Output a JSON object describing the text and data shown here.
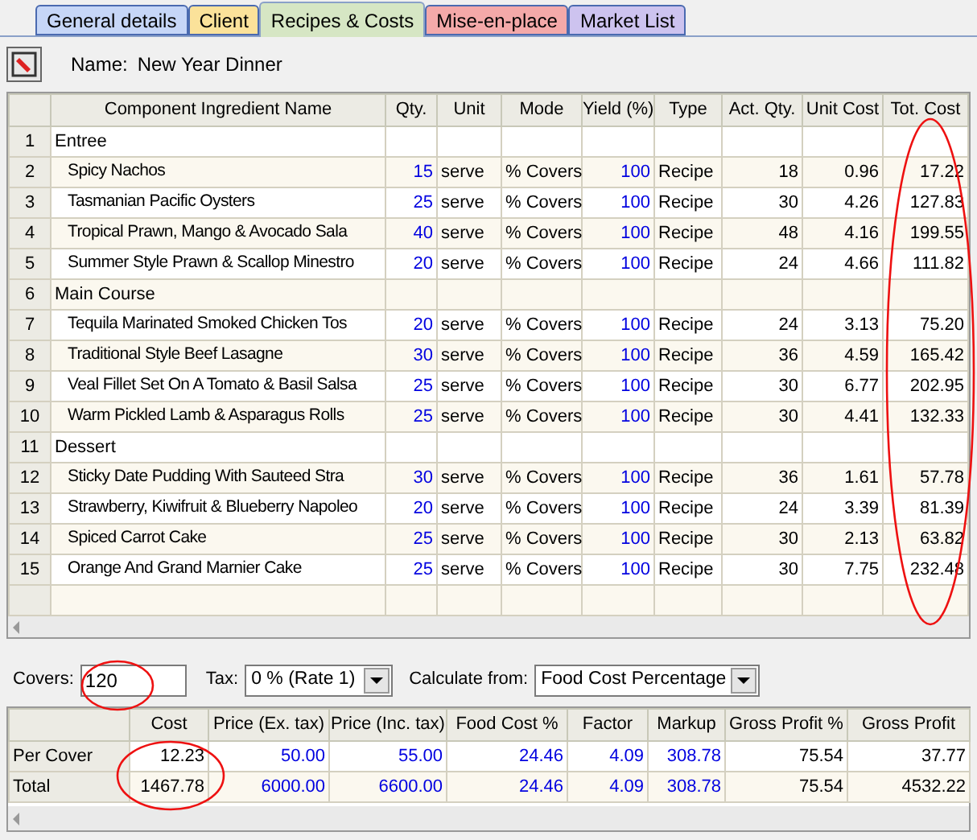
{
  "tabs": [
    {
      "label": "General details",
      "selected": false,
      "color": "#c6d6f7"
    },
    {
      "label": "Client",
      "selected": false,
      "color": "#fbe29a"
    },
    {
      "label": "Recipes & Costs",
      "selected": true,
      "color": "#d6e6c4"
    },
    {
      "label": "Mise-en-place",
      "selected": false,
      "color": "#f4a9a9"
    },
    {
      "label": "Market List",
      "selected": false,
      "color": "#cdc3ef"
    }
  ],
  "name_label": "Name:",
  "name_value": "New Year Dinner",
  "grid": {
    "columns": [
      "Component Ingredient Name",
      "Qty.",
      "Unit",
      "Mode",
      "Yield (%)",
      "Type",
      "Act. Qty.",
      "Unit Cost",
      "Tot. Cost"
    ],
    "rows": [
      {
        "kind": "group",
        "number": "1",
        "name": "Entree"
      },
      {
        "kind": "item",
        "number": "2",
        "name": "Spicy Nachos",
        "qty": "15",
        "unit": "serve",
        "mode": "% Covers",
        "yield": "100",
        "type": "Recipe",
        "act_qty": "18",
        "unit_cost": "0.96",
        "tot_cost": "17.22"
      },
      {
        "kind": "item",
        "number": "3",
        "name": "Tasmanian Pacific Oysters",
        "qty": "25",
        "unit": "serve",
        "mode": "% Covers",
        "yield": "100",
        "type": "Recipe",
        "act_qty": "30",
        "unit_cost": "4.26",
        "tot_cost": "127.83"
      },
      {
        "kind": "item",
        "number": "4",
        "name": "Tropical Prawn, Mango & Avocado Sala",
        "qty": "40",
        "unit": "serve",
        "mode": "% Covers",
        "yield": "100",
        "type": "Recipe",
        "act_qty": "48",
        "unit_cost": "4.16",
        "tot_cost": "199.55"
      },
      {
        "kind": "item",
        "number": "5",
        "name": "Summer Style Prawn & Scallop Minestro",
        "qty": "20",
        "unit": "serve",
        "mode": "% Covers",
        "yield": "100",
        "type": "Recipe",
        "act_qty": "24",
        "unit_cost": "4.66",
        "tot_cost": "111.82"
      },
      {
        "kind": "group",
        "number": "6",
        "name": "Main Course"
      },
      {
        "kind": "item",
        "number": "7",
        "name": "Tequila Marinated Smoked Chicken Tos",
        "qty": "20",
        "unit": "serve",
        "mode": "% Covers",
        "yield": "100",
        "type": "Recipe",
        "act_qty": "24",
        "unit_cost": "3.13",
        "tot_cost": "75.20"
      },
      {
        "kind": "item",
        "number": "8",
        "name": "Traditional Style Beef Lasagne",
        "qty": "30",
        "unit": "serve",
        "mode": "% Covers",
        "yield": "100",
        "type": "Recipe",
        "act_qty": "36",
        "unit_cost": "4.59",
        "tot_cost": "165.42"
      },
      {
        "kind": "item",
        "number": "9",
        "name": "Veal Fillet Set On A Tomato & Basil Salsa",
        "qty": "25",
        "unit": "serve",
        "mode": "% Covers",
        "yield": "100",
        "type": "Recipe",
        "act_qty": "30",
        "unit_cost": "6.77",
        "tot_cost": "202.95"
      },
      {
        "kind": "item",
        "number": "10",
        "name": "Warm Pickled Lamb & Asparagus Rolls",
        "qty": "25",
        "unit": "serve",
        "mode": "% Covers",
        "yield": "100",
        "type": "Recipe",
        "act_qty": "30",
        "unit_cost": "4.41",
        "tot_cost": "132.33"
      },
      {
        "kind": "group",
        "number": "11",
        "name": "Dessert"
      },
      {
        "kind": "item",
        "number": "12",
        "name": "Sticky Date Pudding With Sauteed Stra",
        "qty": "30",
        "unit": "serve",
        "mode": "% Covers",
        "yield": "100",
        "type": "Recipe",
        "act_qty": "36",
        "unit_cost": "1.61",
        "tot_cost": "57.78"
      },
      {
        "kind": "item",
        "number": "13",
        "name": "Strawberry, Kiwifruit & Blueberry Napoleo",
        "qty": "20",
        "unit": "serve",
        "mode": "% Covers",
        "yield": "100",
        "type": "Recipe",
        "act_qty": "24",
        "unit_cost": "3.39",
        "tot_cost": "81.39"
      },
      {
        "kind": "item",
        "number": "14",
        "name": "Spiced Carrot Cake",
        "qty": "25",
        "unit": "serve",
        "mode": "% Covers",
        "yield": "100",
        "type": "Recipe",
        "act_qty": "30",
        "unit_cost": "2.13",
        "tot_cost": "63.82"
      },
      {
        "kind": "item",
        "number": "15",
        "name": "Orange And Grand Marnier Cake",
        "qty": "25",
        "unit": "serve",
        "mode": "% Covers",
        "yield": "100",
        "type": "Recipe",
        "act_qty": "30",
        "unit_cost": "7.75",
        "tot_cost": "232.48"
      }
    ]
  },
  "covers": {
    "label": "Covers:",
    "value": "120"
  },
  "tax": {
    "label": "Tax:",
    "value": "0 % (Rate 1)"
  },
  "calculate_from": {
    "label": "Calculate from:",
    "value": "Food Cost Percentage"
  },
  "summary": {
    "columns": [
      {
        "label": "Cost",
        "editable": false
      },
      {
        "label": "Price (Ex. tax)",
        "editable": true
      },
      {
        "label": "Price (Inc. tax)",
        "editable": true
      },
      {
        "label": "Food Cost %",
        "editable": true
      },
      {
        "label": "Factor",
        "editable": true
      },
      {
        "label": "Markup",
        "editable": true
      },
      {
        "label": "Gross Profit %",
        "editable": false
      },
      {
        "label": "Gross Profit",
        "editable": false
      }
    ],
    "rows": [
      {
        "label": "Per Cover",
        "values": [
          "12.23",
          "50.00",
          "55.00",
          "24.46",
          "4.09",
          "308.78",
          "75.54",
          "37.77"
        ]
      },
      {
        "label": "Total",
        "values": [
          "1467.78",
          "6000.00",
          "6600.00",
          "24.46",
          "4.09",
          "308.78",
          "75.54",
          "4532.22"
        ]
      }
    ]
  }
}
